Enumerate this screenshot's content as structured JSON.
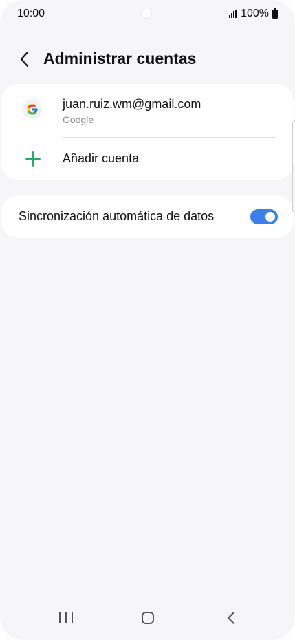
{
  "status_bar": {
    "time": "10:00",
    "battery": "100%",
    "icons": [
      "signal-icon",
      "battery-icon"
    ]
  },
  "header": {
    "title": "Administrar cuentas",
    "back_icon": "chevron-left-icon"
  },
  "accounts": {
    "items": [
      {
        "email": "juan.ruiz.wm@gmail.com",
        "type": "Google",
        "icon": "google-logo"
      }
    ],
    "add_label": "Añadir cuenta",
    "add_icon": "plus-icon"
  },
  "sync": {
    "label": "Sincronización automática de datos",
    "enabled": true
  },
  "nav_bar": {
    "icons": [
      "recents-icon",
      "home-icon",
      "back-icon"
    ]
  },
  "colors": {
    "background": "#f6f6f8",
    "card": "#ffffff",
    "toggle_on": "#3b7fe8",
    "plus": "#2aa96b"
  }
}
